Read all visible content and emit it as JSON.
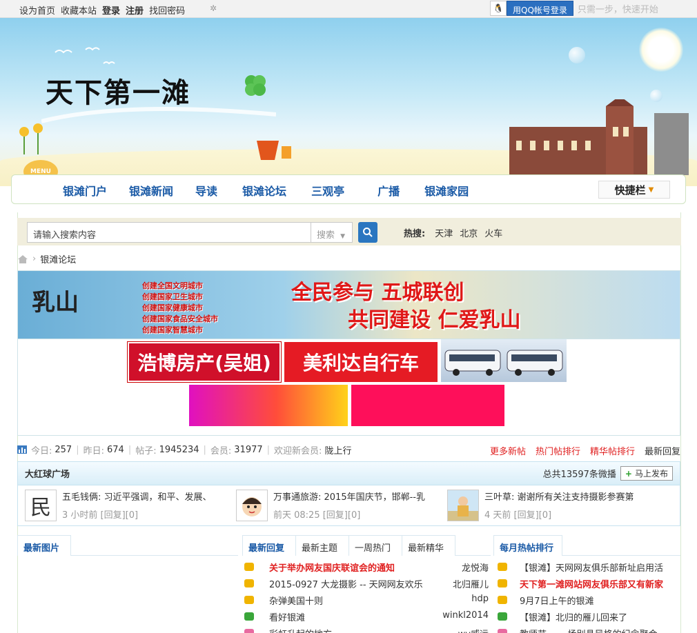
{
  "topbar": {
    "links": [
      "设为首页",
      "收藏本站",
      "登录",
      "注册",
      "找回密码"
    ],
    "qq_login": "用QQ帐号登录",
    "qq_tip": "只需一步，快速开始"
  },
  "header": {
    "logo_text": "天下第一滩",
    "menu_badge": "MENU"
  },
  "nav": {
    "items": [
      "银滩门户",
      "银滩新闻",
      "导读",
      "银滩论坛",
      "三观亭",
      "广播",
      "银滩家园"
    ],
    "quickbar": "快捷栏"
  },
  "search": {
    "placeholder": "请输入搜索内容",
    "type": "搜索",
    "hot_label": "热搜:",
    "hot_terms": [
      "天津",
      "北京",
      "火车"
    ]
  },
  "breadcrumb": {
    "current": "银滩论坛"
  },
  "banner": {
    "logo": "乳山",
    "slogans": [
      "创建全国文明城市",
      "创建国家卫生城市",
      "创建国家健康城市",
      "创建国家食品安全城市",
      "创建国家智慧城市"
    ],
    "line1": "全民参与 五城联创",
    "line2": "共同建设 仁爱乳山"
  },
  "ads": {
    "ad1": "浩博房产(吴姐)",
    "ad2": "美利达自行车"
  },
  "stats": {
    "today_label": "今日:",
    "today": "257",
    "yesterday_label": "昨日:",
    "yesterday": "674",
    "posts_label": "帖子:",
    "posts": "1945234",
    "members_label": "会员:",
    "members": "31977",
    "welcome_label": "欢迎新会员:",
    "newest": "陇上行",
    "links": [
      "更多新帖",
      "热门帖排行",
      "精华帖排行",
      "最新回复"
    ]
  },
  "weibo": {
    "title": "大红球广场",
    "total": "总共13597条微播",
    "publish": "马上发布",
    "items": [
      {
        "avatar": "民",
        "text": "五毛钱俩: 习近平强调，和平、发展、",
        "meta": "3 小时前 [回复][0]"
      },
      {
        "avatar": "",
        "text": "万事通旅游: 2015年国庆节，邯郸--乳",
        "meta": "前天 08:25 [回复][0]"
      },
      {
        "avatar": "",
        "text": "三叶草: 谢谢所有关注支持摄影参赛第",
        "meta": "4 天前 [回复][0]"
      }
    ]
  },
  "panels": {
    "pictures_tab": "最新图片",
    "tabs": [
      "最新回复",
      "最新主题",
      "一周热门",
      "最新精华"
    ],
    "hot_tab": "每月热帖排行",
    "recent": [
      {
        "title": "关于举办网友国庆联谊会的通知",
        "author": "龙悦海",
        "red": true,
        "color": "#f0b400"
      },
      {
        "title": "2015-0927 大龙摄影 -- 天网网友欢乐",
        "author": "北归雁儿",
        "red": false,
        "color": "#f0b400"
      },
      {
        "title": "杂弹美国十则",
        "author": "hdp",
        "red": false,
        "color": "#f0b400"
      },
      {
        "title": "看好银滩",
        "author": "winkl2014",
        "red": false,
        "color": "#3aa63a"
      },
      {
        "title": "彩虹升起的地方",
        "author": "wy威远",
        "red": false,
        "color": "#e86aa0"
      }
    ],
    "hot": [
      {
        "title": "【银滩】天网网友俱乐部新址启用活",
        "red": false,
        "color": "#f0b400"
      },
      {
        "title": "天下第一滩网站网友俱乐部又有新家",
        "red": true,
        "color": "#f0b400"
      },
      {
        "title": "9月7日上午的银滩",
        "red": false,
        "color": "#f0b400"
      },
      {
        "title": "【银滩】北归的雁儿回来了",
        "red": false,
        "color": "#3aa63a"
      },
      {
        "title": "教师节 -- 一场别具风格的纪念聚会",
        "red": false,
        "color": "#e86aa0"
      }
    ]
  }
}
